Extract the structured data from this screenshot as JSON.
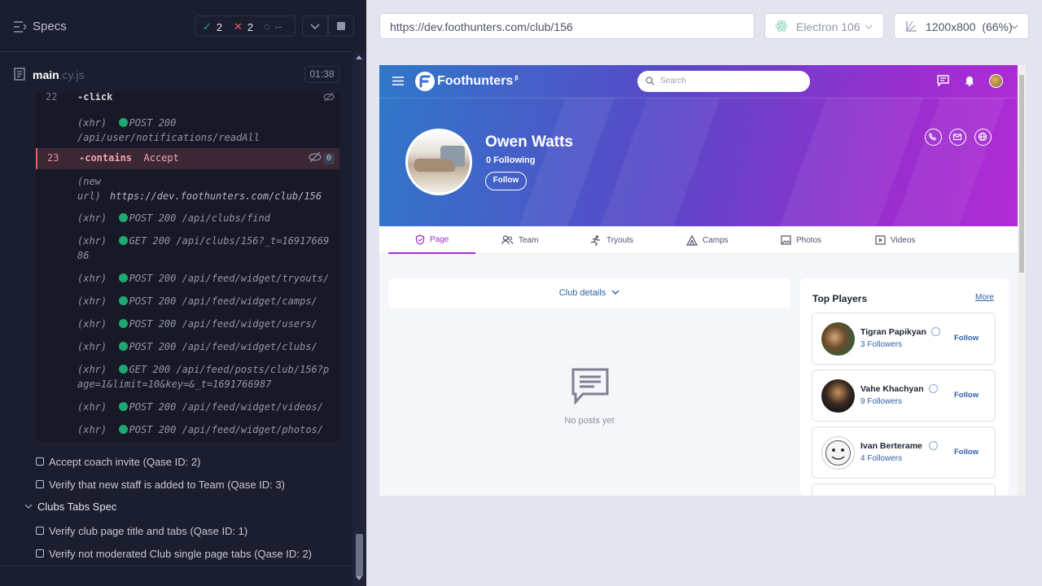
{
  "left": {
    "header": {
      "title": "Specs"
    },
    "stats": {
      "passed": "2",
      "failed": "2",
      "pending": "--"
    },
    "file": {
      "name": "main",
      "ext": ".cy.js",
      "duration": "01:38"
    },
    "commands": [
      {
        "num": "22",
        "name": "-click",
        "arg": ""
      },
      {
        "num": "23",
        "name": "-contains",
        "arg": "Accept",
        "badge": "0"
      }
    ],
    "logs": [
      {
        "type": "(xhr)",
        "method": "POST 200",
        "url": "/api/user/notifications/readAll"
      },
      {
        "type": "(new url)",
        "method": "",
        "url": "https://dev.foothunters.com/club/156"
      },
      {
        "type": "(xhr)",
        "method": "POST 200",
        "url": "/api/clubs/find"
      },
      {
        "type": "(xhr)",
        "method": "GET 200",
        "url": "/api/clubs/156?_t=1691766986"
      },
      {
        "type": "(xhr)",
        "method": "POST 200",
        "url": "/api/feed/widget/tryouts/"
      },
      {
        "type": "(xhr)",
        "method": "POST 200",
        "url": "/api/feed/widget/camps/"
      },
      {
        "type": "(xhr)",
        "method": "POST 200",
        "url": "/api/feed/widget/users/"
      },
      {
        "type": "(xhr)",
        "method": "POST 200",
        "url": "/api/feed/widget/clubs/"
      },
      {
        "type": "(xhr)",
        "method": "GET 200",
        "url": "/api/feed/posts/club/156?page=1&limit=10&key=&_t=1691766987"
      },
      {
        "type": "(xhr)",
        "method": "POST 200",
        "url": "/api/feed/widget/videos/"
      },
      {
        "type": "(xhr)",
        "method": "POST 200",
        "url": "/api/feed/widget/photos/"
      }
    ],
    "tests": [
      {
        "label": "Accept coach invite (Qase ID: 2)"
      },
      {
        "label": "Verify that new staff is added to Team (Qase ID: 3)"
      }
    ],
    "suite": {
      "label": "Clubs Tabs Spec"
    },
    "suite_tests": [
      {
        "label": "Verify club page title and tabs (Qase ID: 1)"
      },
      {
        "label": "Verify not moderated Club single page tabs (Qase ID: 2)"
      }
    ]
  },
  "runner": {
    "url": "https://dev.foothunters.com/club/156",
    "browser": "Electron 106",
    "viewport": "1200x800",
    "scale": "(66%)"
  },
  "app": {
    "brand": "Foothunters",
    "brand_sup": "β",
    "search_placeholder": "Search",
    "profile": {
      "name": "Owen Watts",
      "following": "0 Following",
      "follow_label": "Follow"
    },
    "tabs": [
      {
        "label": "Page",
        "icon": "shield-icon"
      },
      {
        "label": "Team",
        "icon": "users-icon"
      },
      {
        "label": "Tryouts",
        "icon": "running-icon"
      },
      {
        "label": "Camps",
        "icon": "tent-icon"
      },
      {
        "label": "Photos",
        "icon": "image-icon"
      },
      {
        "label": "Videos",
        "icon": "video-icon"
      }
    ],
    "club_details": "Club details",
    "no_posts": "No posts yet",
    "top_players": {
      "title": "Top Players",
      "more": "More",
      "players": [
        {
          "name": "Tigran Papikyan",
          "followers": "3 Followers",
          "follow": "Follow"
        },
        {
          "name": "Vahe Khachyan",
          "followers": "9 Followers",
          "follow": "Follow"
        },
        {
          "name": "Ivan Berterame",
          "followers": "4 Followers",
          "follow": "Follow"
        }
      ]
    }
  },
  "colors": {
    "accent": "#a02fd2",
    "link": "#2f5ea8",
    "success": "#1fa971",
    "fail": "#ef5b6b"
  }
}
